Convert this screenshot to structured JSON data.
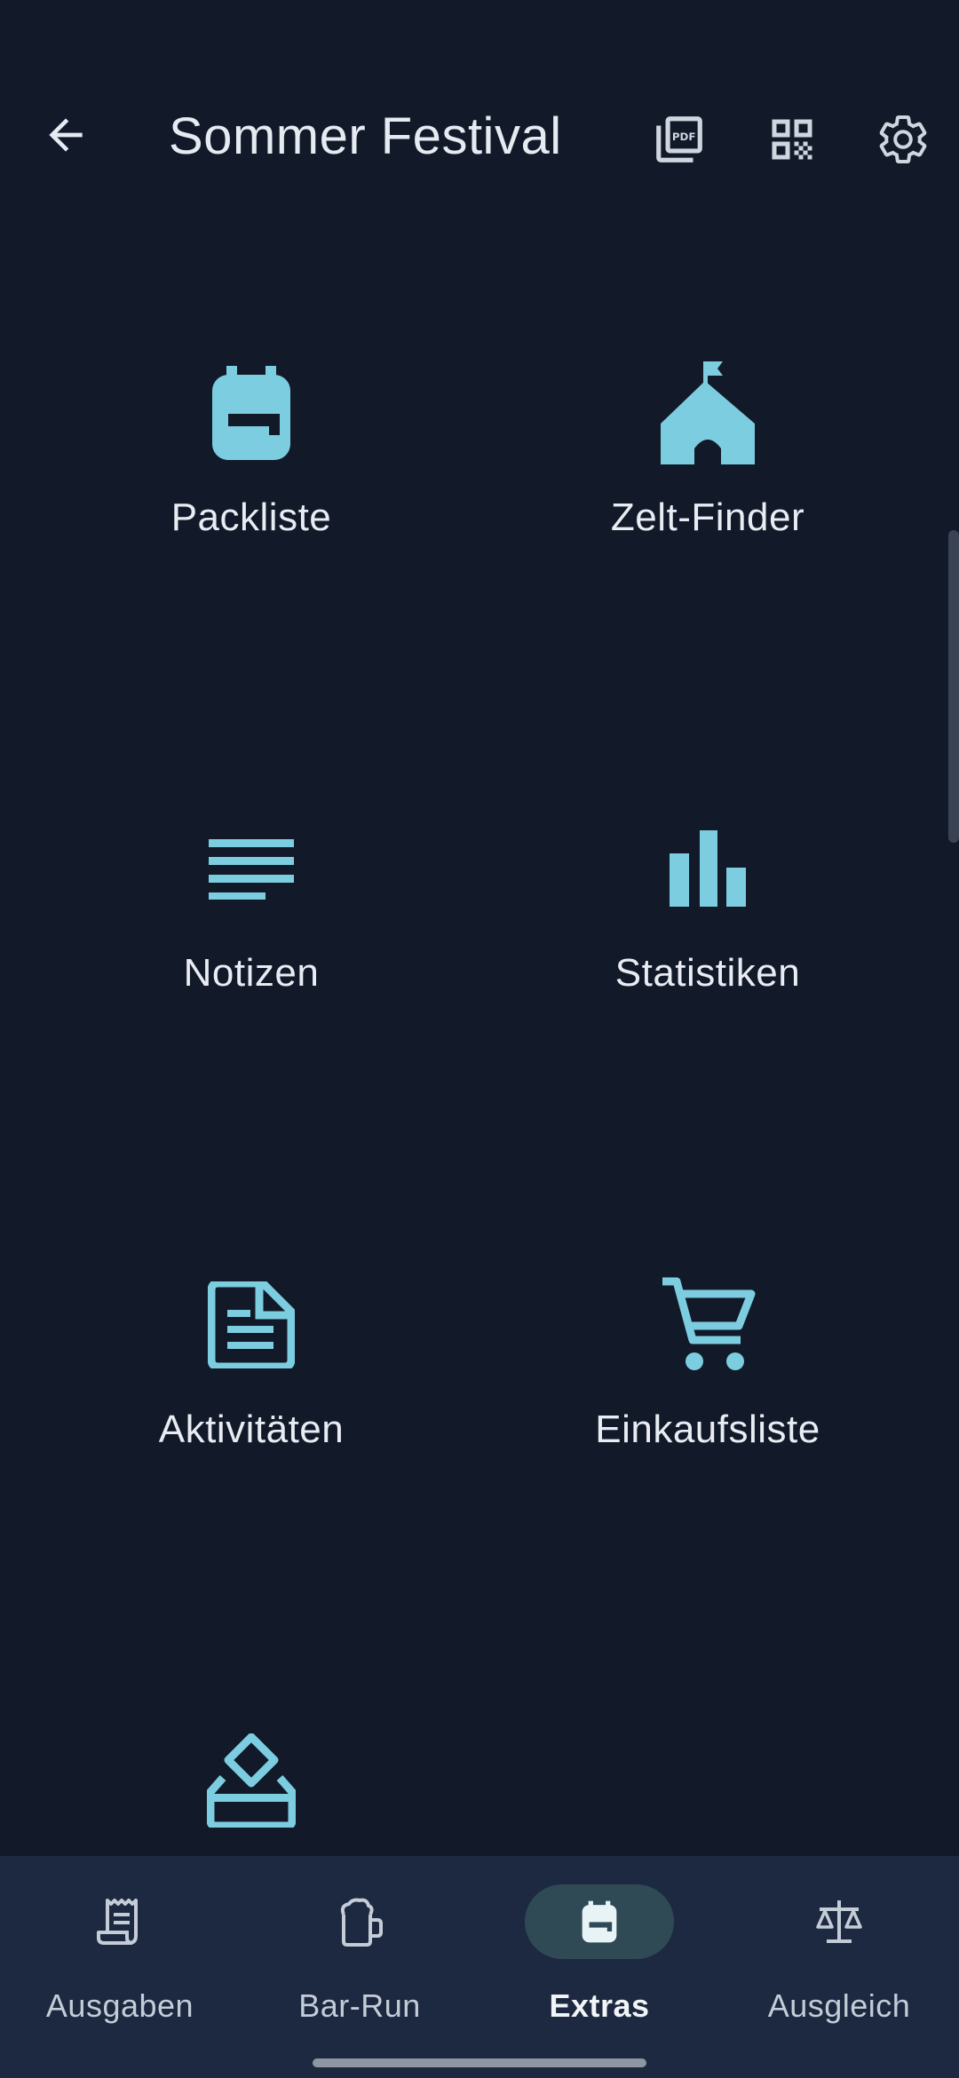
{
  "app": {
    "title": "Sommer Festival",
    "accent_color": "#7ccde0",
    "background_color": "#121929",
    "nav_background_color": "#1d2940"
  },
  "header": {
    "back_icon": "arrow-left-icon",
    "actions": [
      {
        "icon": "pdf-export-icon"
      },
      {
        "icon": "qr-code-icon"
      },
      {
        "icon": "gear-icon"
      }
    ]
  },
  "extras": [
    {
      "label": "Packliste",
      "icon": "backpack-icon"
    },
    {
      "label": "Zelt-Finder",
      "icon": "tent-icon"
    },
    {
      "label": "Notizen",
      "icon": "notes-icon"
    },
    {
      "label": "Statistiken",
      "icon": "bar-chart-icon"
    },
    {
      "label": "Aktivitäten",
      "icon": "document-icon"
    },
    {
      "label": "Einkaufsliste",
      "icon": "shopping-cart-icon"
    },
    {
      "label": "",
      "icon": "ballot-box-icon"
    }
  ],
  "bottom_nav": {
    "items": [
      {
        "label": "Ausgaben",
        "icon": "receipt-icon",
        "active": false
      },
      {
        "label": "Bar-Run",
        "icon": "beer-mug-icon",
        "active": false
      },
      {
        "label": "Extras",
        "icon": "backpack-icon",
        "active": true
      },
      {
        "label": "Ausgleich",
        "icon": "balance-scale-icon",
        "active": false
      }
    ]
  }
}
